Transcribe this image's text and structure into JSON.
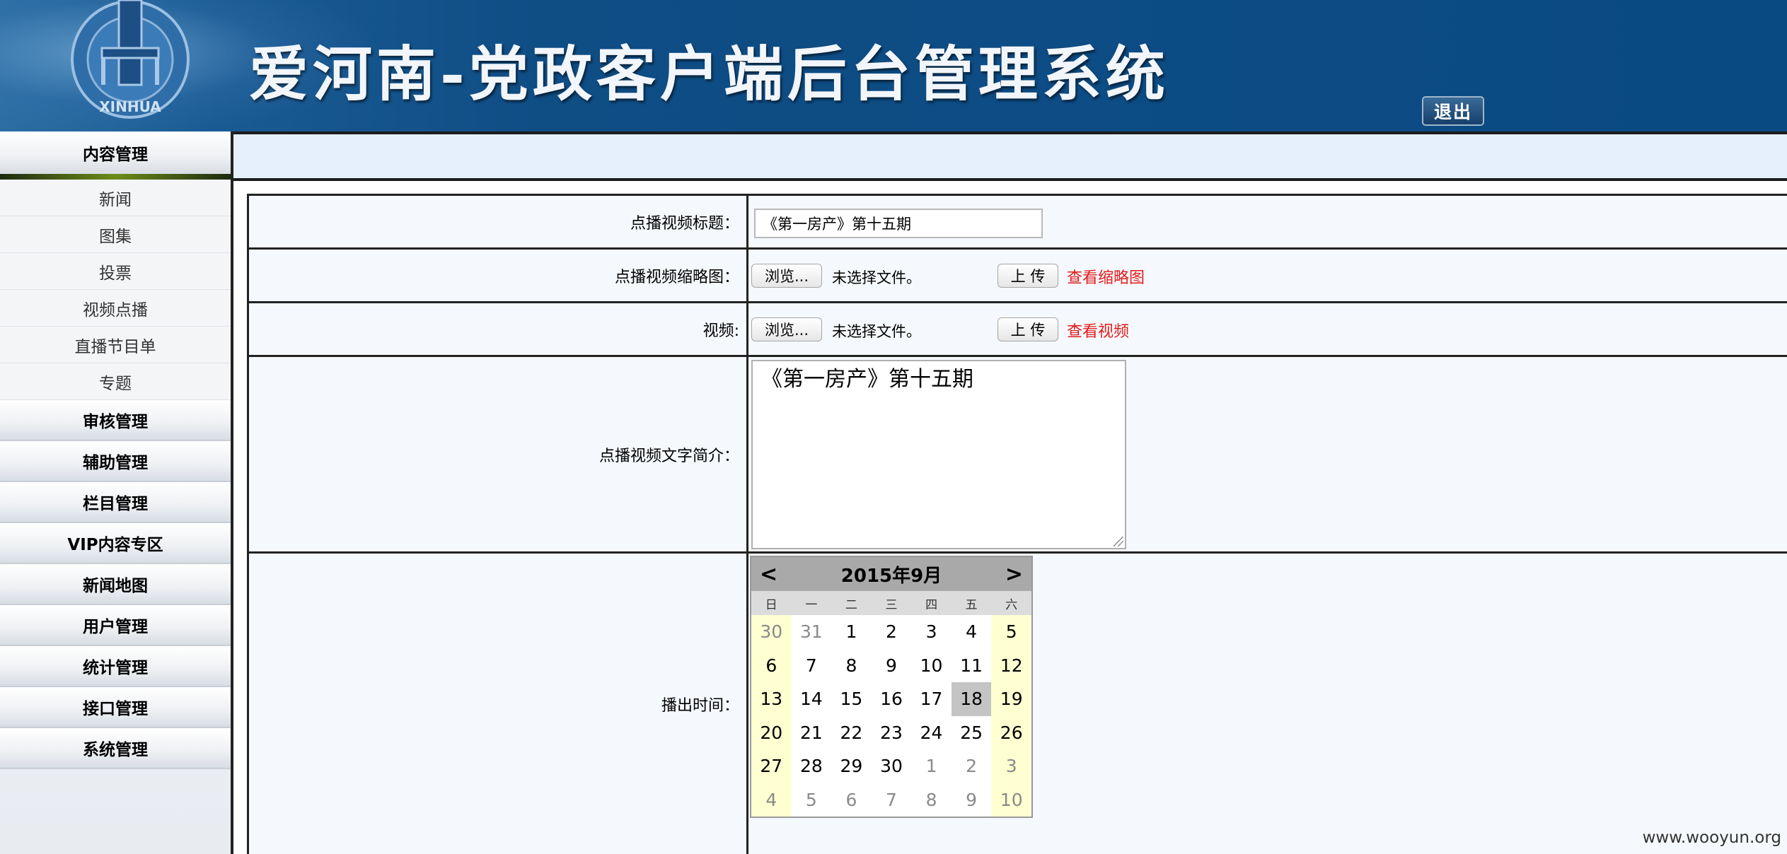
{
  "header": {
    "title": "爱河南-党政客户端后台管理系统",
    "logo_text": "XINHUA",
    "logout_label": "退出"
  },
  "sidebar": {
    "active_category": "内容管理",
    "sub_items": [
      "新闻",
      "图集",
      "投票",
      "视频点播",
      "直播节目单",
      "专题"
    ],
    "categories": [
      "审核管理",
      "辅助管理",
      "栏目管理",
      "VIP内容专区",
      "新闻地图",
      "用户管理",
      "统计管理",
      "接口管理",
      "系统管理"
    ]
  },
  "form": {
    "title_label": "点播视频标题：",
    "title_value": "《第一房产》第十五期",
    "thumb_label": "点播视频缩略图：",
    "video_label": "视频:",
    "browse_label": "浏览...",
    "no_file_text": "未选择文件。",
    "upload_label": "上 传",
    "view_thumb_link": "查看缩略图",
    "view_video_link": "查看视频",
    "desc_label": "点播视频文字简介：",
    "desc_value": "《第一房产》第十五期",
    "airtime_label": "播出时间："
  },
  "calendar": {
    "prev": "<",
    "next": ">",
    "month_label": "2015年9月",
    "weekdays": [
      "日",
      "一",
      "二",
      "三",
      "四",
      "五",
      "六"
    ],
    "selected_day": "18",
    "weeks": [
      [
        "30",
        "31",
        "1",
        "2",
        "3",
        "4",
        "5"
      ],
      [
        "6",
        "7",
        "8",
        "9",
        "10",
        "11",
        "12"
      ],
      [
        "13",
        "14",
        "15",
        "16",
        "17",
        "18",
        "19"
      ],
      [
        "20",
        "21",
        "22",
        "23",
        "24",
        "25",
        "26"
      ],
      [
        "27",
        "28",
        "29",
        "30",
        "1",
        "2",
        "3"
      ],
      [
        "4",
        "5",
        "6",
        "7",
        "8",
        "9",
        "10"
      ]
    ]
  },
  "watermark": "www.wooyun.org",
  "colors": {
    "header_bg": "#0a4a82",
    "link_red": "#e21c1c",
    "weekend_bg": "#ffffd2",
    "selected_bg": "#c4c4c4"
  }
}
